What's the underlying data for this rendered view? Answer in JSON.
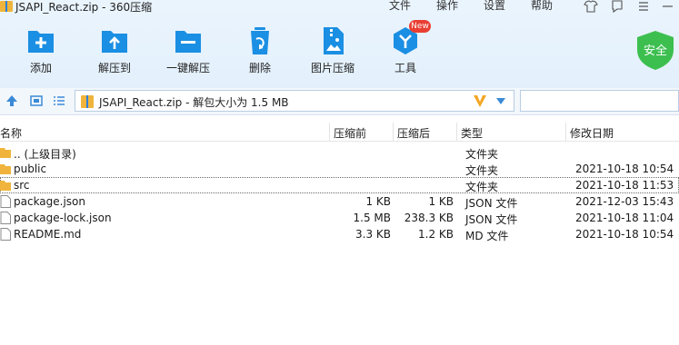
{
  "window": {
    "title": "JSAPI_React.zip - 360压缩"
  },
  "menu": [
    "文件",
    "操作",
    "设置",
    "帮助"
  ],
  "toolbar": {
    "add": "添加",
    "extract_to": "解压到",
    "one_click_extract": "一键解压",
    "delete": "删除",
    "image_compress": "图片压缩",
    "tools": "工具",
    "new_badge": "New"
  },
  "security": {
    "label": "安全"
  },
  "address": {
    "text": "JSAPI_React.zip - 解包大小为 1.5 MB"
  },
  "columns": {
    "name": "名称",
    "packed": "压缩前",
    "unpacked": "压缩后",
    "type": "类型",
    "modified": "修改日期"
  },
  "files": [
    {
      "name": ".. (上级目录)",
      "packed": "",
      "unpacked": "",
      "type": "文件夹",
      "date": "",
      "kind": "folder"
    },
    {
      "name": "public",
      "packed": "",
      "unpacked": "",
      "type": "文件夹",
      "date": "2021-10-18 10:54",
      "kind": "folder"
    },
    {
      "name": "src",
      "packed": "",
      "unpacked": "",
      "type": "文件夹",
      "date": "2021-10-18 11:53",
      "kind": "folder"
    },
    {
      "name": "package.json",
      "packed": "1 KB",
      "unpacked": "1 KB",
      "type": "JSON 文件",
      "date": "2021-12-03 15:43",
      "kind": "file"
    },
    {
      "name": "package-lock.json",
      "packed": "1.5 MB",
      "unpacked": "238.3 KB",
      "type": "JSON 文件",
      "date": "2021-10-18 11:04",
      "kind": "file"
    },
    {
      "name": "README.md",
      "packed": "3.3 KB",
      "unpacked": "1.2 KB",
      "type": "MD 文件",
      "date": "2021-10-18 10:54",
      "kind": "file"
    }
  ],
  "colors": {
    "accent": "#1a8fe3",
    "brand_green": "#3dbf4f",
    "badge_red": "#e93f33",
    "folder": "#f0b43c"
  }
}
